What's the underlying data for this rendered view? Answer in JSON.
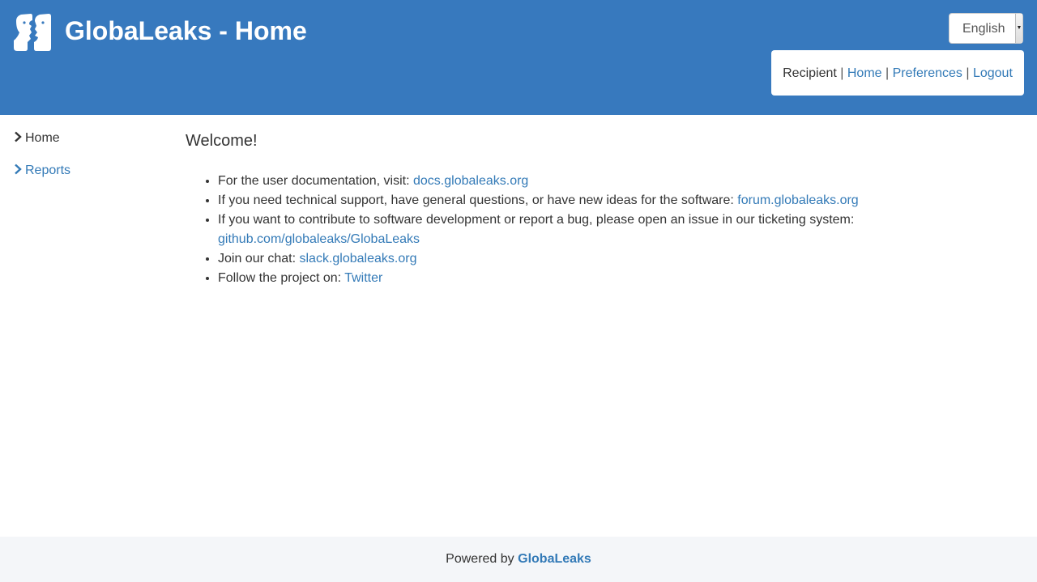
{
  "header": {
    "title": "GlobaLeaks - Home",
    "logo_icon": "globaleaks-logo-icon",
    "background_color": "#3779be"
  },
  "language_select": {
    "selected": "English"
  },
  "user_nav": {
    "role": "Recipient",
    "separator": "|",
    "home_label": "Home",
    "preferences_label": "Preferences",
    "logout_label": "Logout"
  },
  "sidebar": {
    "items": [
      {
        "label": "Home",
        "icon": "chevron-right-icon",
        "active": true
      },
      {
        "label": "Reports",
        "icon": "chevron-right-icon",
        "active": false
      }
    ]
  },
  "main": {
    "welcome": "Welcome!",
    "items": [
      {
        "text": "For the user documentation, visit: ",
        "link": "docs.globaleaks.org"
      },
      {
        "text": "If you need technical support, have general questions, or have new ideas for the software: ",
        "link": "forum.globaleaks.org"
      },
      {
        "text": "If you want to contribute to software development or report a bug, please open an issue in our ticketing system: ",
        "link": "github.com/globaleaks/GlobaLeaks"
      },
      {
        "text": "Join our chat: ",
        "link": "slack.globaleaks.org"
      },
      {
        "text": "Follow the project on: ",
        "link": "Twitter"
      }
    ]
  },
  "footer": {
    "prefix": "Powered by",
    "brand": "GlobaLeaks"
  },
  "colors": {
    "accent": "#337ab7",
    "footer_background": "#f4f6f9"
  }
}
